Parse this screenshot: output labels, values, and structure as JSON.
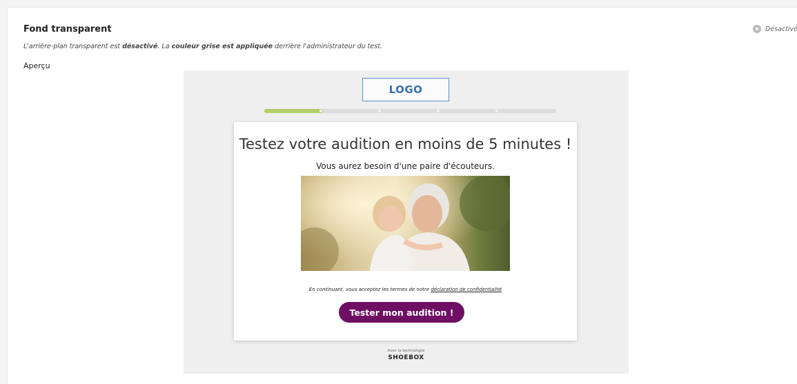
{
  "section": {
    "title": "Fond transparent",
    "description_parts": [
      "L'arrière-plan transparent est ",
      "désactivé",
      ". La ",
      "couleur grise est appliquée",
      " derrière l'administrateur du test."
    ],
    "status_label": "Désactivé",
    "status_icon": "close-circle-icon",
    "preview_label": "Aperçu"
  },
  "preview": {
    "background_color": "#efefef",
    "logo_text": "LOGO",
    "progress": {
      "fraction": 0.2,
      "steps": 5,
      "color": "#b3cf6b"
    },
    "card": {
      "headline": "Testez votre audition en moins de 5 minutes !",
      "subheadline": "Vous aurez besoin d'une paire d'écouteurs.",
      "image_description": "grandmother-and-child-photo",
      "terms_prefix": "En continuant, vous acceptez les termes de notre ",
      "terms_link": "déclaration de confidentialité",
      "cta_label": "Tester mon audition !",
      "cta_color": "#6e0f63"
    },
    "footer": {
      "powered_by": "Avec la technologie",
      "brand": "SHOEBOX"
    }
  }
}
